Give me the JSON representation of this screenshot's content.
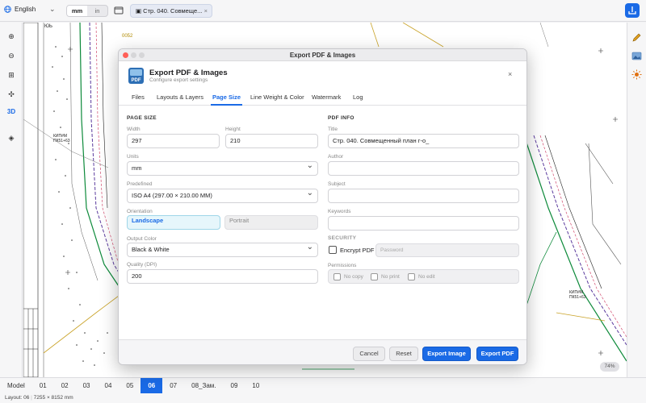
{
  "topbar": {
    "language": "English",
    "units": [
      "mm",
      "in"
    ],
    "active_unit": "mm",
    "document_tab": "Стр. 040. Совмеще...",
    "icons": [
      "globe-icon",
      "chevron-down-icon",
      "document-icon",
      "close-icon",
      "save-icon"
    ]
  },
  "left_tools": [
    "zoom-in-icon",
    "zoom-out-icon",
    "fit-icon",
    "pan-icon",
    "3D",
    "layers-icon"
  ],
  "right_tools": [
    "pencil-icon",
    "image-icon",
    "sun-icon"
  ],
  "canvas": {
    "labels": [
      "ЮЬ",
      "0052",
      "КИП#М",
      "ПК51+63",
      "КИП#М",
      "ПК51+63"
    ],
    "zoom": "74%"
  },
  "layout_tabs": [
    "Model",
    "01",
    "02",
    "03",
    "04",
    "05",
    "06",
    "07",
    "08_Зам.",
    "09",
    "10"
  ],
  "active_layout": "06",
  "status": {
    "layout": "Layout: 06",
    "size": "7255 × 8152 mm"
  },
  "dialog": {
    "window_title": "Export PDF & Images",
    "title": "Export PDF & Images",
    "subtitle": "Configure export settings",
    "tabs": [
      "Files",
      "Layouts & Layers",
      "Page Size",
      "Line Weight & Color",
      "Watermark",
      "Log"
    ],
    "active_tab": "Page Size",
    "page_size": {
      "section": "PAGE SIZE",
      "width_label": "Width",
      "width": "297",
      "height_label": "Height",
      "height": "210",
      "units_label": "Units",
      "units": "mm",
      "predefined_label": "Predefined",
      "predefined": "ISO A4 (297.00 × 210.00 MM)",
      "orientation_label": "Orientation",
      "orientation_options": [
        "Landscape",
        "Portrait"
      ],
      "orientation": "Landscape",
      "output_color_label": "Output Color",
      "output_color": "Black & White",
      "quality_label": "Quality (DPI)",
      "quality": "200"
    },
    "pdf_info": {
      "section": "PDF INFO",
      "title_label": "Title",
      "title": "Стр. 040. Совмещенный план г-о_",
      "author_label": "Author",
      "author": "",
      "subject_label": "Subject",
      "subject": "",
      "keywords_label": "Keywords",
      "keywords": "",
      "security_section": "SECURITY",
      "encrypt_label": "Encrypt PDF",
      "encrypt_checked": false,
      "password_placeholder": "Password",
      "permissions_label": "Permissions",
      "permissions": [
        "No copy",
        "No print",
        "No edit"
      ]
    },
    "buttons": {
      "cancel": "Cancel",
      "reset": "Reset",
      "export_image": "Export Image",
      "export_pdf": "Export PDF"
    }
  },
  "colors": {
    "accent": "#1a6ae6",
    "canvas_green": "#0d8a3a",
    "canvas_purple": "#5b3b9e",
    "canvas_gold": "#c9a227"
  }
}
